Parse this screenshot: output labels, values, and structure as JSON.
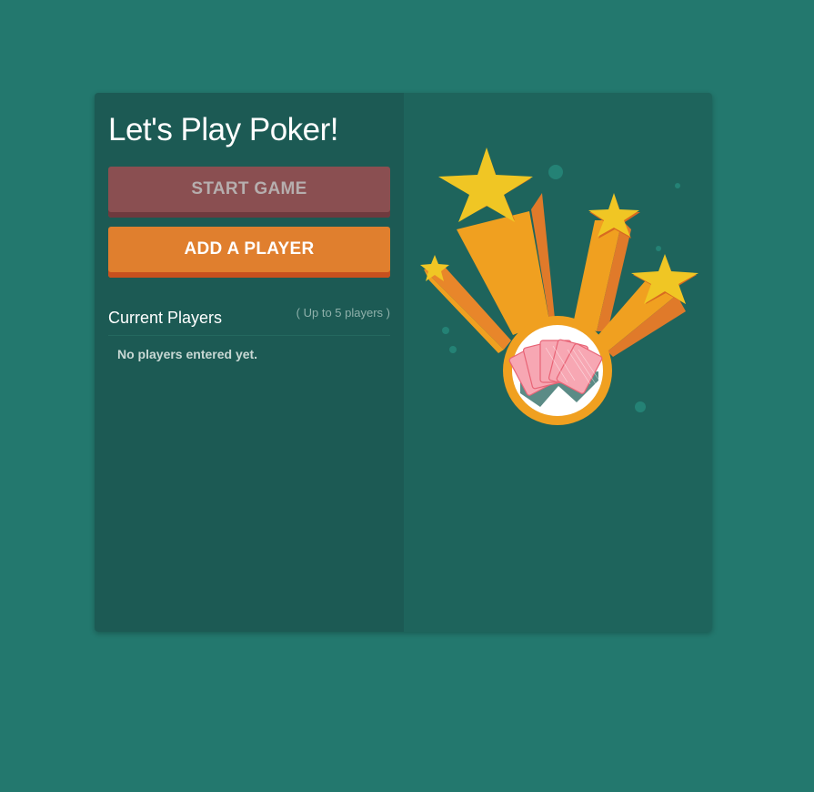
{
  "app": {
    "title": "Let's Play Poker!"
  },
  "actions": {
    "start_label": "START GAME",
    "add_label": "ADD A PLAYER"
  },
  "players": {
    "heading": "Current Players",
    "limit_note": "( Up to 5 players )",
    "empty_message": "No players entered yet.",
    "list": []
  },
  "illustration": {
    "icon": "stars-burst-playing-cards-icon"
  },
  "colors": {
    "page_bg": "#23786e",
    "left_panel": "#1c5a54",
    "right_panel": "#1e645c",
    "start_button": "#8a4f51",
    "add_button": "#e07f2e",
    "star": "#f0c624",
    "ring": "#f0a020"
  }
}
